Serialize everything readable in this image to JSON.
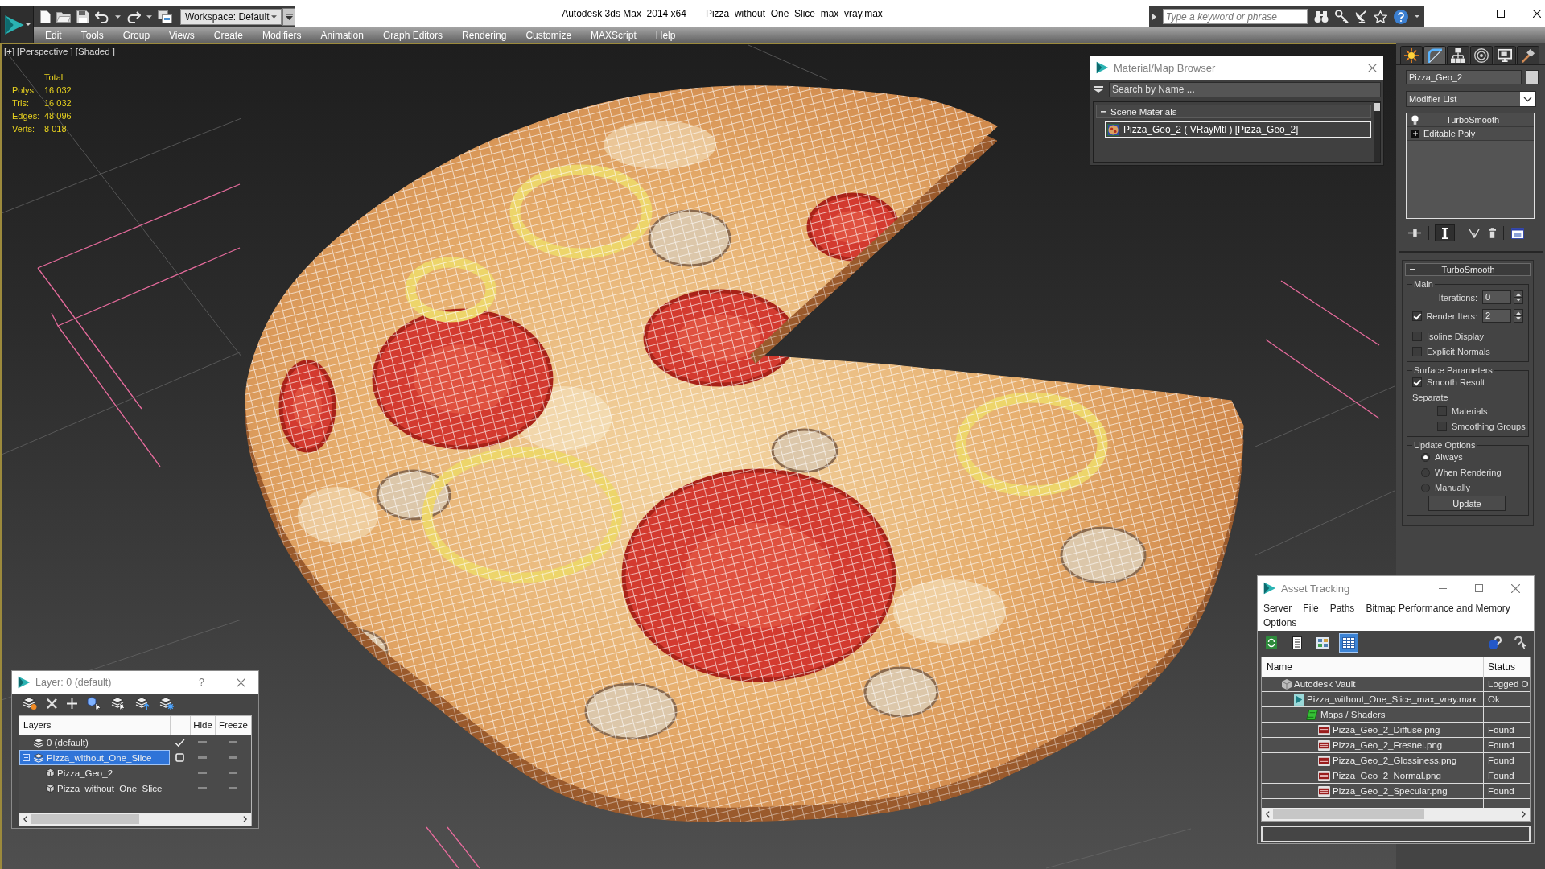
{
  "title_bar": {
    "workspace": "Workspace: Default",
    "app_title": "Autodesk 3ds Max  2014 x64",
    "file_title": "Pizza_without_One_Slice_max_vray.max",
    "search": {
      "placeholder": "Type a keyword or phrase"
    }
  },
  "menu": [
    "Edit",
    "Tools",
    "Group",
    "Views",
    "Create",
    "Modifiers",
    "Animation",
    "Graph Editors",
    "Rendering",
    "Customize",
    "MAXScript",
    "Help"
  ],
  "viewport": {
    "labels": [
      "[+]",
      "[Perspective ]",
      "[Shaded ]"
    ],
    "stats": {
      "heading": "Total",
      "rows": [
        {
          "label": "Polys:",
          "value": "16 032"
        },
        {
          "label": "Tris:",
          "value": "16 032"
        },
        {
          "label": "Edges:",
          "value": "48 096"
        },
        {
          "label": "Verts:",
          "value": "8 018"
        }
      ]
    }
  },
  "material_browser": {
    "title": "Material/Map Browser",
    "search": {
      "placeholder": "Search by Name ..."
    },
    "groups": [
      {
        "label": "Scene Materials",
        "expanded": true,
        "items": [
          {
            "name": "Pizza_Geo_2 ( VRayMtl ) [Pizza_Geo_2]",
            "selected": true
          }
        ]
      }
    ]
  },
  "command_panel": {
    "tabs": [
      {
        "kind": "create",
        "selected": false
      },
      {
        "kind": "modify",
        "selected": true
      },
      {
        "kind": "hierarchy",
        "selected": false
      },
      {
        "kind": "motion",
        "selected": false
      },
      {
        "kind": "display",
        "selected": false
      },
      {
        "kind": "utilities",
        "selected": false
      }
    ],
    "object_name": "Pizza_Geo_2",
    "modifier_list": "Modifier List",
    "stack": [
      {
        "kind": "modifier",
        "name": "TurboSmooth"
      },
      {
        "kind": "base",
        "name": "Editable Poly",
        "expanded": false
      }
    ],
    "stack_tools": [
      {
        "kind": "pin",
        "pressed": false
      },
      {
        "kind": "end_result",
        "pressed": true
      },
      {
        "kind": "make_unique",
        "pressed": false
      },
      {
        "kind": "remove",
        "pressed": false
      },
      {
        "kind": "configure",
        "pressed": false
      }
    ],
    "rollout": {
      "title": "TurboSmooth",
      "expanded": true,
      "groups": [
        {
          "title": "Main",
          "controls": [
            {
              "kind": "spinner",
              "label": "Iterations:",
              "value": "0"
            },
            {
              "kind": "spinner",
              "label": "Render Iters:",
              "value": "2",
              "checked": true
            },
            {
              "kind": "checkbox",
              "label": "Isoline Display",
              "checked": false
            },
            {
              "kind": "checkbox",
              "label": "Explicit Normals",
              "checked": false
            }
          ]
        },
        {
          "title": "Surface Parameters",
          "controls": [
            {
              "kind": "checkbox",
              "label": "Smooth Result",
              "checked": true
            },
            {
              "kind": "label",
              "label": "Separate",
              "children": [
                {
                  "kind": "checkbox",
                  "label": "Materials",
                  "checked": false
                },
                {
                  "kind": "checkbox",
                  "label": "Smoothing Groups",
                  "checked": false
                }
              ]
            }
          ]
        },
        {
          "title": "Update Options",
          "controls": [
            {
              "kind": "radio",
              "label": "Always",
              "selected": true
            },
            {
              "kind": "radio",
              "label": "When Rendering",
              "selected": false
            },
            {
              "kind": "radio",
              "label": "Manually",
              "selected": false
            },
            {
              "kind": "button",
              "label": "Update"
            }
          ]
        }
      ]
    }
  },
  "layer_manager": {
    "title": "Layer: 0 (default)",
    "help": "?",
    "columns": [
      "Layers",
      "Hide",
      "Freeze"
    ],
    "layers": [
      {
        "kind": "layer",
        "name": "0 (default)",
        "current": true,
        "selected": false,
        "hidden": false,
        "frozen": false
      },
      {
        "kind": "layer",
        "name": "Pizza_without_One_Slice",
        "current": false,
        "selected": true,
        "expanded": true,
        "hidden": false,
        "frozen": false,
        "children": [
          {
            "kind": "object",
            "name": "Pizza_Geo_2",
            "selected": false,
            "hidden": false,
            "frozen": false
          },
          {
            "kind": "object",
            "name": "Pizza_without_One_Slice",
            "selected": false,
            "hidden": false,
            "frozen": false
          }
        ]
      }
    ]
  },
  "asset_tracking": {
    "title": "Asset Tracking",
    "menu": [
      "Server",
      "File",
      "Paths",
      "Bitmap Performance and Memory",
      "Options"
    ],
    "tools": [
      {
        "kind": "refresh",
        "selected": false
      },
      {
        "kind": "list",
        "selected": false
      },
      {
        "kind": "thumbnails",
        "selected": false
      },
      {
        "kind": "table",
        "selected": true
      }
    ],
    "columns": [
      "Name",
      "Status"
    ],
    "assets": [
      {
        "kind": "vault",
        "name": "Autodesk Vault",
        "status": "Logged O",
        "children": [
          {
            "kind": "max",
            "name": "Pizza_without_One_Slice_max_vray.max",
            "status": "Ok",
            "children": [
              {
                "kind": "folder",
                "name": "Maps / Shaders",
                "children": [
                  {
                    "kind": "png",
                    "name": "Pizza_Geo_2_Diffuse.png",
                    "status": "Found"
                  },
                  {
                    "kind": "png",
                    "name": "Pizza_Geo_2_Fresnel.png",
                    "status": "Found"
                  },
                  {
                    "kind": "png",
                    "name": "Pizza_Geo_2_Glossiness.png",
                    "status": "Found"
                  },
                  {
                    "kind": "png",
                    "name": "Pizza_Geo_2_Normal.png",
                    "status": "Found"
                  },
                  {
                    "kind": "png",
                    "name": "Pizza_Geo_2_Specular.png",
                    "status": "Found"
                  }
                ]
              }
            ]
          }
        ]
      }
    ]
  }
}
